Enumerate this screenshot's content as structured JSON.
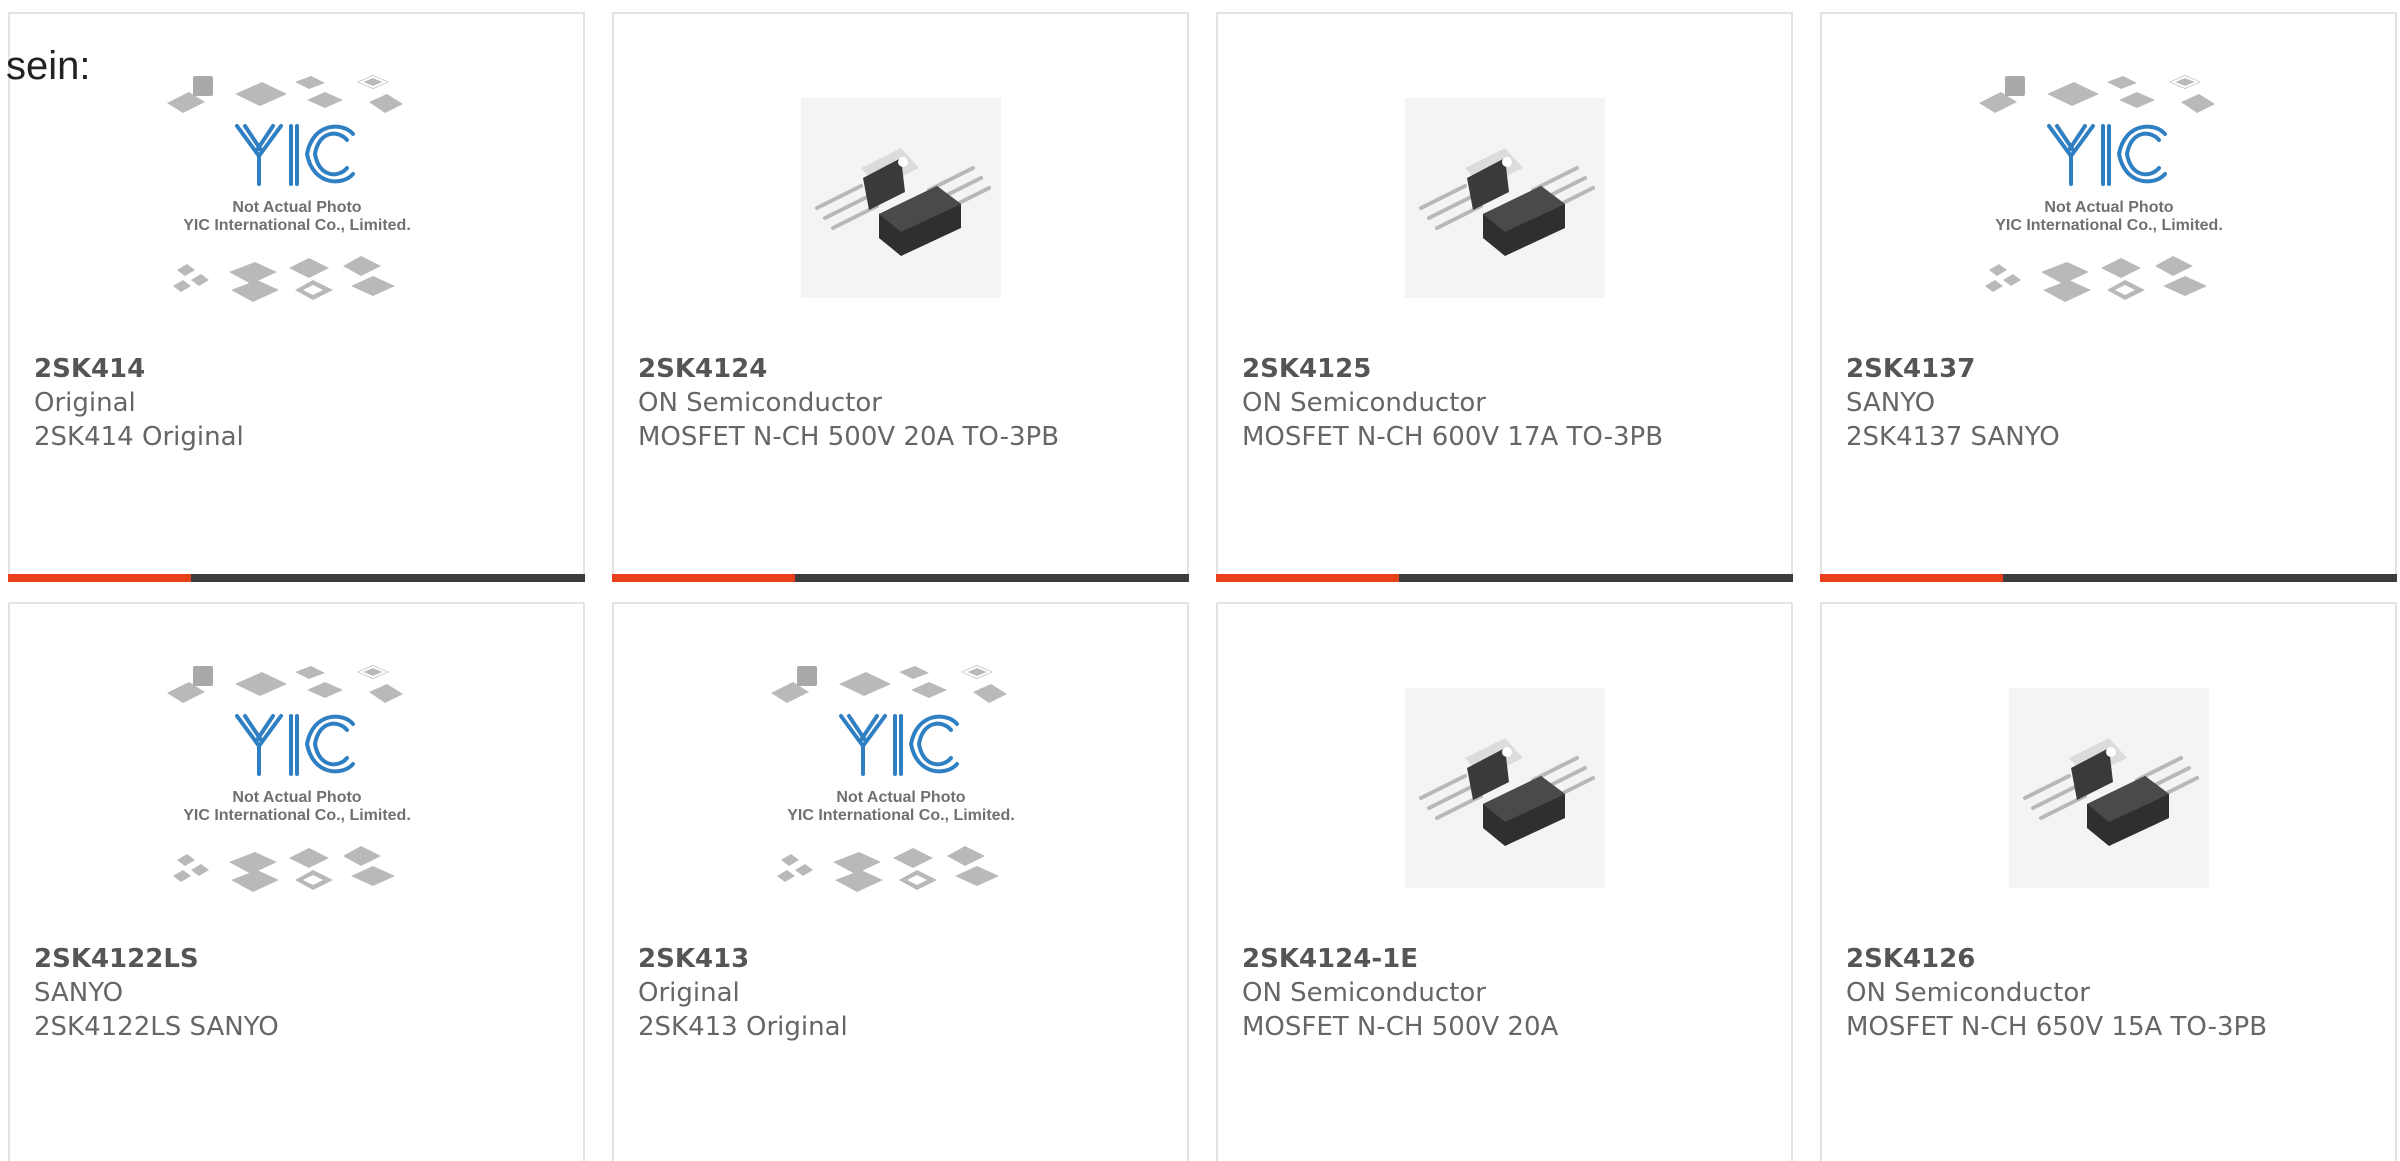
{
  "intro_text": "sein:",
  "accent_color": "#e8411b",
  "bar_color": "#3d3d3d",
  "placeholder_caption": {
    "logo": "YIC",
    "line1": "Not Actual Photo",
    "line2": "YIC International Co., Limited."
  },
  "products": [
    {
      "part": "2SK414",
      "maker": "Original",
      "desc": "2SK414 Original",
      "image": "placeholder"
    },
    {
      "part": "2SK4124",
      "maker": "ON Semiconductor",
      "desc": "MOSFET N-CH 500V 20A TO-3PB",
      "image": "to3p-transistor"
    },
    {
      "part": "2SK4125",
      "maker": "ON Semiconductor",
      "desc": "MOSFET N-CH 600V 17A TO-3PB",
      "image": "to3p-transistor"
    },
    {
      "part": "2SK4137",
      "maker": "SANYO",
      "desc": "2SK4137 SANYO",
      "image": "placeholder"
    },
    {
      "part": "2SK4122LS",
      "maker": "SANYO",
      "desc": "2SK4122LS SANYO",
      "image": "placeholder"
    },
    {
      "part": "2SK413",
      "maker": "Original",
      "desc": "2SK413 Original",
      "image": "placeholder"
    },
    {
      "part": "2SK4124-1E",
      "maker": "ON Semiconductor",
      "desc": "MOSFET N-CH 500V 20A",
      "image": "to3p-transistor"
    },
    {
      "part": "2SK4126",
      "maker": "ON Semiconductor",
      "desc": "MOSFET N-CH 650V 15A TO-3PB",
      "image": "to3p-transistor"
    }
  ]
}
